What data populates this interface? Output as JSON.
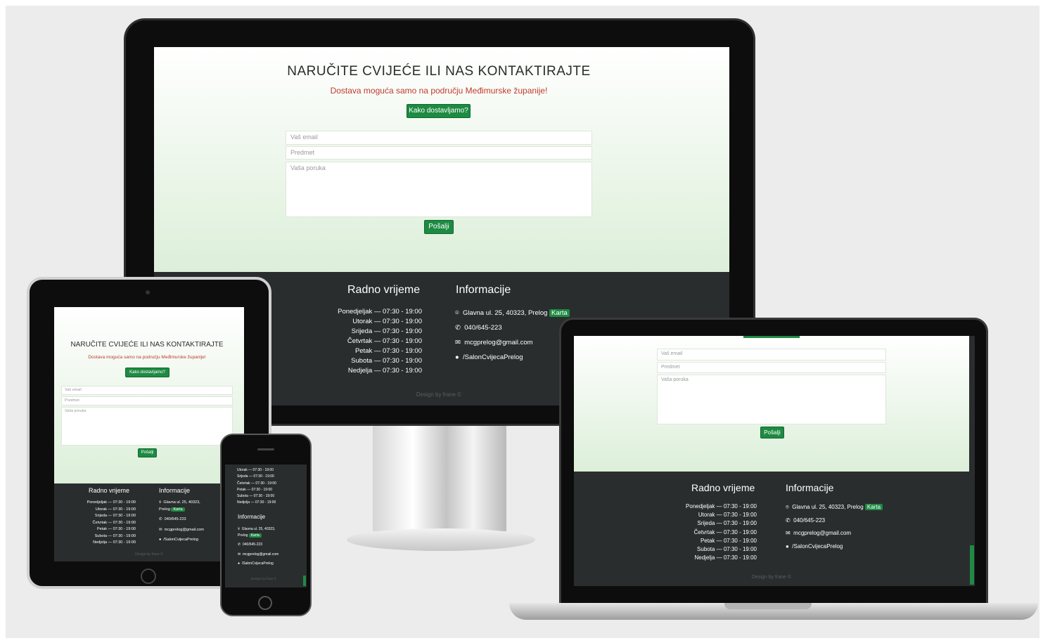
{
  "form": {
    "title": "NARUČITE CVIJEĆE ILI NAS KONTAKTIRAJTE",
    "notice": "Dostava moguća samo na području Međimurske županije!",
    "delivery_button": "Kako dostavljamo?",
    "email_placeholder": "Vaš email",
    "subject_placeholder": "Predmet",
    "message_placeholder": "Vaša poruka",
    "send_button": "Pošalji"
  },
  "footer": {
    "hours_title": "Radno vrijeme",
    "info_title": "Informacije",
    "hours": [
      "Ponedjeljak — 07:30 - 19:00",
      "Utorak — 07:30 - 19:00",
      "Srijeda — 07:30 - 19:00",
      "Četvrtak — 07:30 - 19:00",
      "Petak — 07:30 - 19:00",
      "Subota — 07:30 - 19:00",
      "Nedjelja — 07:30 - 19:00"
    ],
    "address": "Glavna ul. 25, 40323, Prelog",
    "address_line1": "Glavna ul. 25, 40323,",
    "address_line2": "Prelog",
    "map_button": "Karta",
    "phone": "040/645-223",
    "email": "mcgprelog@gmail.com",
    "facebook": "/SalonCvijecaPrelog",
    "credit": "Design by frane ©"
  },
  "colors": {
    "accent": "#1e8a43",
    "notice": "#c23a2b",
    "footer_bg": "#2a2d2e",
    "page_bg": "#ececec"
  }
}
